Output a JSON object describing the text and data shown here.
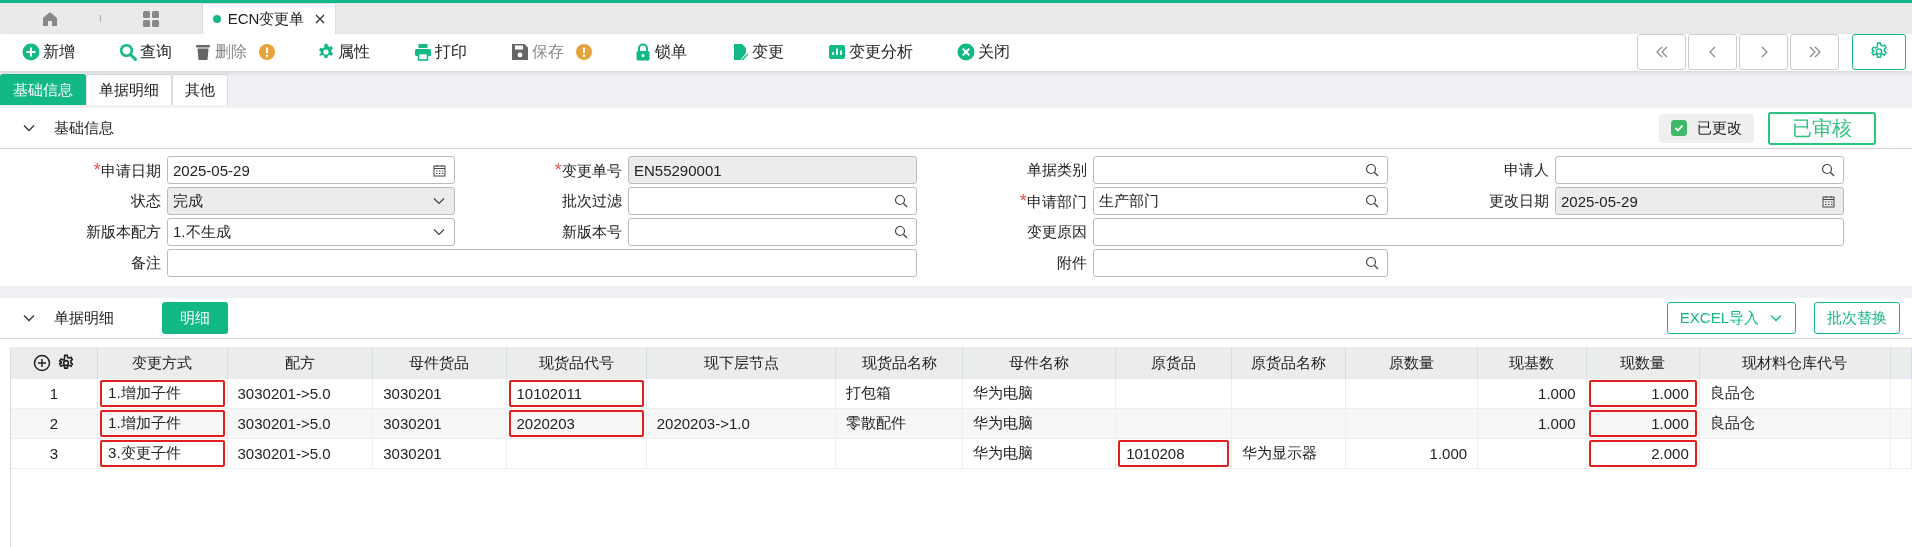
{
  "tabs": [
    {
      "kind": "home",
      "selected": false
    },
    {
      "kind": "apps",
      "selected": false
    },
    {
      "kind": "document",
      "label": "ECN变更单",
      "selected": true
    }
  ],
  "toolbar": [
    {
      "kind": "add",
      "label": "新增",
      "disabled": false,
      "warning": false
    },
    {
      "kind": "search",
      "label": "查询",
      "disabled": false,
      "warning": false
    },
    {
      "kind": "delete",
      "label": "删除",
      "disabled": true,
      "warning": true
    },
    {
      "kind": "properties",
      "label": "属性",
      "disabled": false,
      "warning": false
    },
    {
      "kind": "print",
      "label": "打印",
      "disabled": false,
      "warning": false
    },
    {
      "kind": "save",
      "label": "保存",
      "disabled": true,
      "warning": true
    },
    {
      "kind": "lock",
      "label": "锁单",
      "disabled": false,
      "warning": false
    },
    {
      "kind": "change",
      "label": "变更",
      "disabled": false,
      "warning": false
    },
    {
      "kind": "analysis",
      "label": "变更分析",
      "disabled": false,
      "warning": false
    },
    {
      "kind": "close",
      "label": "关闭",
      "disabled": false,
      "warning": false
    }
  ],
  "nav_buttons": [
    {
      "kind": "first"
    },
    {
      "kind": "previous"
    },
    {
      "kind": "next"
    },
    {
      "kind": "last"
    },
    {
      "kind": "settings"
    }
  ],
  "sub_tabs": [
    {
      "label": "基础信息",
      "selected": true
    },
    {
      "label": "单据明细",
      "selected": false
    },
    {
      "label": "其他",
      "selected": false
    }
  ],
  "basic_section": {
    "title": "基础信息",
    "expanded": true,
    "changed": {
      "label": "已更改",
      "checked": true
    },
    "stamp": "已审核",
    "fields": [
      {
        "label": "申请日期",
        "required_mark": "*",
        "kind": "date",
        "value": "2025-05-29",
        "readonly": false,
        "wide": false
      },
      {
        "label": "变更单号",
        "required_mark": "*",
        "kind": "text",
        "value": "EN55290001",
        "readonly": true,
        "wide": false
      },
      {
        "label": "单据类别",
        "kind": "lookup",
        "readonly": false,
        "wide": false
      },
      {
        "label": "申请人",
        "kind": "lookup",
        "readonly": false,
        "wide": false
      },
      {
        "label": "状态",
        "kind": "select",
        "value": "完成",
        "readonly": true,
        "wide": false
      },
      {
        "label": "批次过滤",
        "kind": "lookup",
        "readonly": false,
        "wide": false
      },
      {
        "label": "申请部门",
        "required_mark": "*",
        "kind": "lookup",
        "value": "生产部门",
        "readonly": false,
        "wide": false
      },
      {
        "label": "更改日期",
        "kind": "date",
        "value": "2025-05-29",
        "readonly": true,
        "wide": false
      },
      {
        "label": "新版本配方",
        "kind": "select",
        "value": "1.不生成",
        "readonly": false,
        "wide": false
      },
      {
        "label": "新版本号",
        "kind": "lookup",
        "readonly": false,
        "wide": false
      },
      {
        "label": "变更原因",
        "kind": "text",
        "readonly": false,
        "wide": true
      },
      {
        "label": "备注",
        "kind": "text",
        "readonly": false,
        "wide": true
      },
      {
        "label": "附件",
        "kind": "lookup",
        "readonly": false,
        "wide": false
      }
    ]
  },
  "detail_section": {
    "title": "单据明细",
    "expanded": true,
    "detail_button": "明细",
    "import_button": "EXCEL导入",
    "replace_button": "批次替换"
  },
  "table": {
    "columns": [
      {
        "label": "变更方式",
        "numeric": false
      },
      {
        "label": "配方",
        "numeric": false
      },
      {
        "label": "母件货品",
        "numeric": false
      },
      {
        "label": "现货品代号",
        "numeric": false
      },
      {
        "label": "现下层节点",
        "numeric": false
      },
      {
        "label": "现货品名称",
        "numeric": false
      },
      {
        "label": "母件名称",
        "numeric": false
      },
      {
        "label": "原货品",
        "numeric": false
      },
      {
        "label": "原货品名称",
        "numeric": false
      },
      {
        "label": "原数量",
        "numeric": true
      },
      {
        "label": "现基数",
        "numeric": true
      },
      {
        "label": "现数量",
        "numeric": true
      },
      {
        "label": "现材料仓库代号",
        "numeric": false
      }
    ],
    "rows": [
      {
        "index": "1",
        "cells": [
          {
            "text": "1.增加子件",
            "marked": true
          },
          {
            "text": "3030201->5.0",
            "marked": false
          },
          {
            "text": "3030201",
            "marked": false
          },
          {
            "text": "10102011",
            "marked": true
          },
          {
            "marked": false
          },
          {
            "text": "打包箱",
            "marked": false
          },
          {
            "text": "华为电脑",
            "marked": false
          },
          {
            "marked": false
          },
          {
            "marked": false
          },
          {
            "marked": false
          },
          {
            "text": "1.000",
            "marked": false
          },
          {
            "text": "1.000",
            "marked": true
          },
          {
            "text": "良品仓",
            "marked": false
          }
        ]
      },
      {
        "index": "2",
        "cells": [
          {
            "text": "1.增加子件",
            "marked": true
          },
          {
            "text": "3030201->5.0",
            "marked": false
          },
          {
            "text": "3030201",
            "marked": false
          },
          {
            "text": "2020203",
            "marked": true
          },
          {
            "text": "2020203->1.0",
            "marked": false
          },
          {
            "text": "零散配件",
            "marked": false
          },
          {
            "text": "华为电脑",
            "marked": false
          },
          {
            "marked": false
          },
          {
            "marked": false
          },
          {
            "marked": false
          },
          {
            "text": "1.000",
            "marked": false
          },
          {
            "text": "1.000",
            "marked": true
          },
          {
            "text": "良品仓",
            "marked": false
          }
        ]
      },
      {
        "index": "3",
        "cells": [
          {
            "text": "3.变更子件",
            "marked": true
          },
          {
            "text": "3030201->5.0",
            "marked": false
          },
          {
            "text": "3030201",
            "marked": false
          },
          {
            "marked": false
          },
          {
            "marked": false
          },
          {
            "marked": false
          },
          {
            "text": "华为电脑",
            "marked": false
          },
          {
            "text": "1010208",
            "marked": true
          },
          {
            "text": "华为显示器",
            "marked": false
          },
          {
            "text": "1.000",
            "marked": false
          },
          {
            "marked": false
          },
          {
            "text": "2.000",
            "marked": true
          },
          {
            "marked": false
          }
        ]
      }
    ]
  }
}
